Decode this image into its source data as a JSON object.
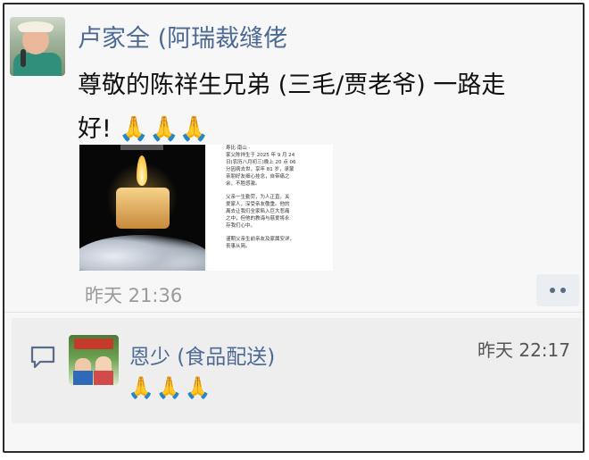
{
  "post": {
    "author_name": "卢家全 (阿瑞裁缝佬",
    "text_line1": "尊敬的陈祥生兄弟 (三毛/贾老爷) 一路走",
    "text_line2": "好! 🙏🙏🙏",
    "time": "昨天 21:36",
    "doc_lines": [
      "寿比·南山 ·",
      "家父陈祥生于 2025 年 9 月 24",
      "日(农历八月初三)晚上 20 点 06",
      "分因病去世，享年 81 岁，承蒙",
      "亲朋好友细心挂念，自带痛之",
      "余，不胜感激。",
      "",
      "父亲一生勤劳，为人正直，关",
      "爱家人，深受亲友敬重。他的",
      "离去让我们全家陷入巨大悲痛",
      "之中，但他的教诲与慈爱将永",
      "存我们心中。",
      "",
      "谨期父亲生前亲友及家属安详，",
      "丧事从简。"
    ]
  },
  "comment": {
    "name": "恩少 (食品配送)",
    "time": "昨天 22:17",
    "text": "🙏🙏🙏"
  }
}
